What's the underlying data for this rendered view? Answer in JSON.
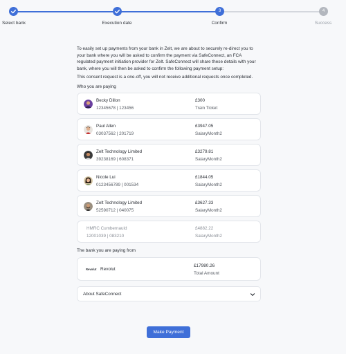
{
  "stepper": {
    "steps": [
      {
        "label": "Select bank",
        "state": "done"
      },
      {
        "label": "Execution date",
        "state": "done"
      },
      {
        "label": "Confirm",
        "state": "current",
        "number": "3"
      },
      {
        "label": "Success",
        "state": "todo",
        "number": "4"
      }
    ],
    "accent": "#3f6fd8"
  },
  "intro": {
    "paragraph1": "To easily set up payments from your bank in Zelt, we are about to securely re-direct you to your bank where you will be asked to confirm the payment via SafeConnect, an FCA regulated payment initiation provider for Zelt. SafeConnect will share these details with your bank, where you will then be asked to confirm the following payment setup:",
    "paragraph2": "This consent request is a one-off, you will not receive additional requests once completed."
  },
  "payees": {
    "title": "Who you are paying",
    "items": [
      {
        "name": "Becky Dillon",
        "account": "12345678 | 123456",
        "amount": "£300",
        "reference": "Train Ticket",
        "avatar": "avatar-purple"
      },
      {
        "name": "Paul Allen",
        "account": "03037562 | 201719",
        "amount": "£3947.05",
        "reference": "SalaryMonth2",
        "avatar": "avatar-man"
      },
      {
        "name": "Zelt Technology Limited",
        "account": "39238169 | 608371",
        "amount": "£3279.81",
        "reference": "SalaryMonth2",
        "avatar": "avatar-man-dark"
      },
      {
        "name": "Nicole Lui",
        "account": "0123456789 | 001534",
        "amount": "£1844.05",
        "reference": "SalaryMonth2",
        "avatar": "avatar-woman"
      },
      {
        "name": "Zelt Technology Limited",
        "account": "52590712 | 040075",
        "amount": "£3627.33",
        "reference": "SalaryMonth2",
        "avatar": "avatar-man-beard"
      },
      {
        "name": "HMRC Cumbernauld",
        "account": "12001039 | 083210",
        "amount": "£4882.22",
        "reference": "SalaryMonth2",
        "avatar": ""
      }
    ]
  },
  "bank": {
    "title": "The bank you are paying from",
    "logo": "Revolut",
    "name": "Revolut",
    "total": "£17980.26",
    "total_label": "Total Amount"
  },
  "accordion": {
    "label": "About SafeConnect"
  },
  "actions": {
    "make_payment": "Make Payment"
  }
}
